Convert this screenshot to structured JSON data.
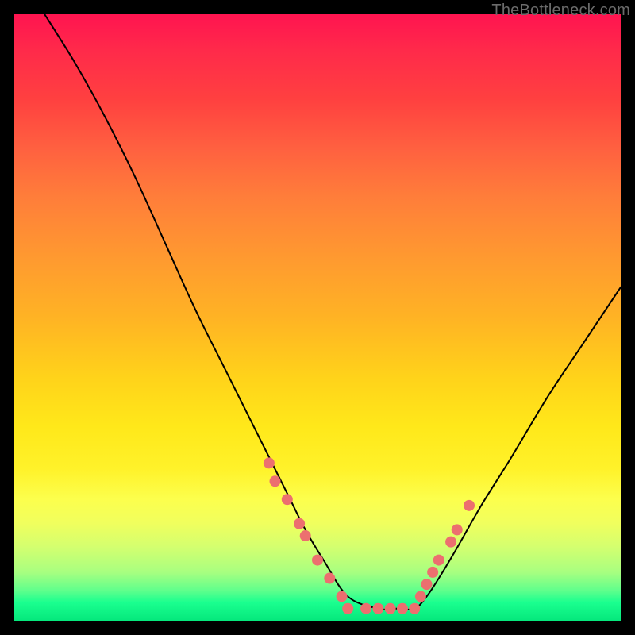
{
  "watermark": "TheBottleneck.com",
  "colors": {
    "background": "#000000",
    "curve": "#000000",
    "dot": "#ec6f6f"
  },
  "chart_data": {
    "type": "line",
    "title": "",
    "xlabel": "",
    "ylabel": "",
    "xlim": [
      0,
      100
    ],
    "ylim": [
      0,
      100
    ],
    "grid": false,
    "legend": false,
    "description": "Bottleneck-style V-curve on red→green gradient; valley around x≈55–66, pink dots cluster on both limbs near the valley.",
    "series": [
      {
        "name": "curve",
        "x": [
          5,
          10,
          15,
          20,
          25,
          30,
          35,
          40,
          45,
          48,
          51,
          55,
          60,
          63,
          66,
          68,
          70,
          73,
          77,
          82,
          88,
          94,
          100
        ],
        "values": [
          100,
          92,
          83,
          73,
          62,
          51,
          41,
          31,
          21,
          15,
          10,
          4,
          2,
          2,
          2,
          4,
          7,
          12,
          19,
          27,
          37,
          46,
          55
        ]
      },
      {
        "name": "left-dots",
        "type": "scatter",
        "x": [
          42,
          43,
          45,
          47,
          48,
          50,
          52,
          54
        ],
        "values": [
          26,
          23,
          20,
          16,
          14,
          10,
          7,
          4
        ]
      },
      {
        "name": "valley-dots",
        "type": "scatter",
        "x": [
          55,
          58,
          60,
          62,
          64,
          66
        ],
        "values": [
          2,
          2,
          2,
          2,
          2,
          2
        ]
      },
      {
        "name": "right-dots",
        "type": "scatter",
        "x": [
          67,
          68,
          69,
          70,
          72,
          73,
          75
        ],
        "values": [
          4,
          6,
          8,
          10,
          13,
          15,
          19
        ]
      }
    ]
  }
}
